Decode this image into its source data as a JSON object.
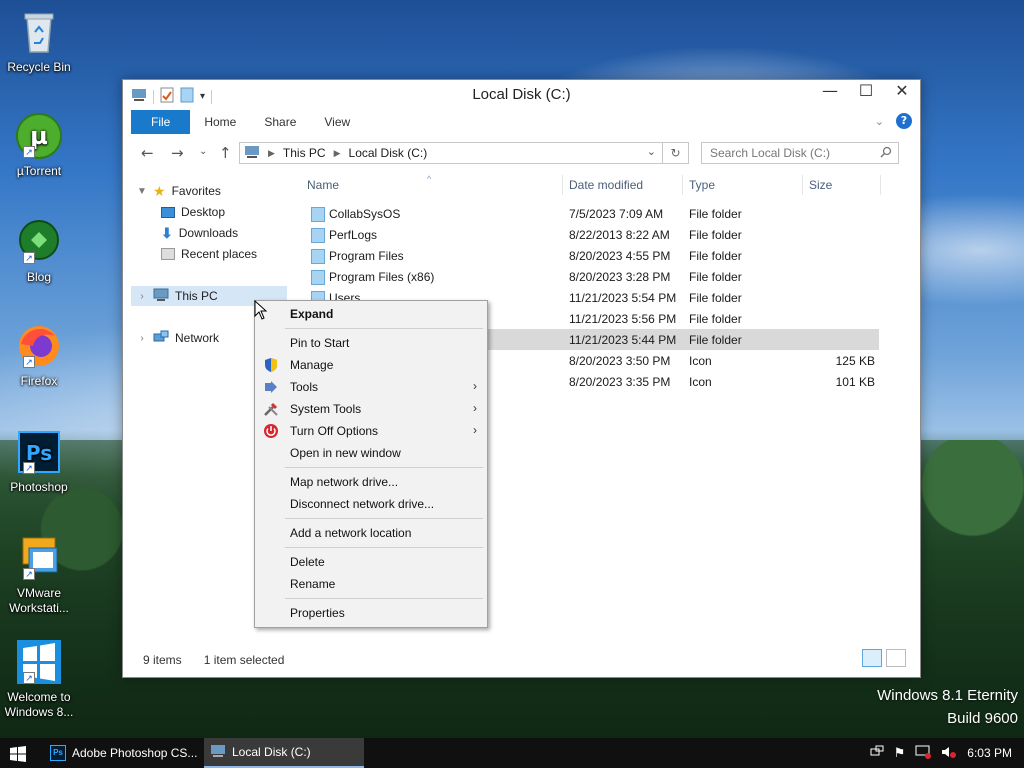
{
  "desktop": {
    "icons": [
      {
        "label": "Recycle Bin"
      },
      {
        "label": "µTorrent"
      },
      {
        "label": "Blog"
      },
      {
        "label": "Firefox"
      },
      {
        "label": "Photoshop"
      },
      {
        "label": "VMware Workstati..."
      },
      {
        "label": "Welcome to Windows 8..."
      }
    ],
    "watermark": {
      "line1": "Windows 8.1 Eternity",
      "line2": "Build 9600"
    }
  },
  "window": {
    "title": "Local Disk (C:)",
    "tabs": {
      "file": "File",
      "home": "Home",
      "share": "Share",
      "view": "View"
    },
    "help_label": "?",
    "address": {
      "crumb1": "This PC",
      "crumb2": "Local Disk (C:)"
    },
    "search_placeholder": "Search Local Disk (C:)",
    "nav": {
      "favorites": "Favorites",
      "desktop": "Desktop",
      "downloads": "Downloads",
      "recent": "Recent places",
      "this_pc": "This PC",
      "network": "Network"
    },
    "columns": {
      "name": "Name",
      "date": "Date modified",
      "type": "Type",
      "size": "Size"
    },
    "files": [
      {
        "name": "CollabSysOS",
        "date": "7/5/2023 7:09 AM",
        "type": "File folder",
        "size": ""
      },
      {
        "name": "PerfLogs",
        "date": "8/22/2013 8:22 AM",
        "type": "File folder",
        "size": ""
      },
      {
        "name": "Program Files",
        "date": "8/20/2023 4:55 PM",
        "type": "File folder",
        "size": ""
      },
      {
        "name": "Program Files (x86)",
        "date": "8/20/2023 3:28 PM",
        "type": "File folder",
        "size": ""
      },
      {
        "name": "Users",
        "date": "11/21/2023 5:54 PM",
        "type": "File folder",
        "size": ""
      },
      {
        "name": "",
        "date": "11/21/2023 5:56 PM",
        "type": "File folder",
        "size": ""
      },
      {
        "name": "",
        "date": "11/21/2023 5:44 PM",
        "type": "File folder",
        "size": ""
      },
      {
        "name": "",
        "date": "8/20/2023 3:50 PM",
        "type": "Icon",
        "size": "125 KB"
      },
      {
        "name": "",
        "date": "8/20/2023 3:35 PM",
        "type": "Icon",
        "size": "101 KB"
      }
    ],
    "status": {
      "items": "9 items",
      "selected": "1 item selected"
    }
  },
  "context_menu": {
    "expand": "Expand",
    "pin": "Pin to Start",
    "manage": "Manage",
    "tools": "Tools",
    "system_tools": "System Tools",
    "turn_off": "Turn Off Options",
    "open_new": "Open in new window",
    "map_drive": "Map network drive...",
    "disconnect": "Disconnect network drive...",
    "add_location": "Add a network location",
    "delete": "Delete",
    "rename": "Rename",
    "properties": "Properties"
  },
  "taskbar": {
    "photoshop": "Adobe Photoshop CS...",
    "explorer": "Local Disk (C:)",
    "clock": "6:03 PM"
  },
  "colors": {
    "accent": "#1979ca",
    "selection": "#cce8ff",
    "taskbar": "#101010"
  }
}
